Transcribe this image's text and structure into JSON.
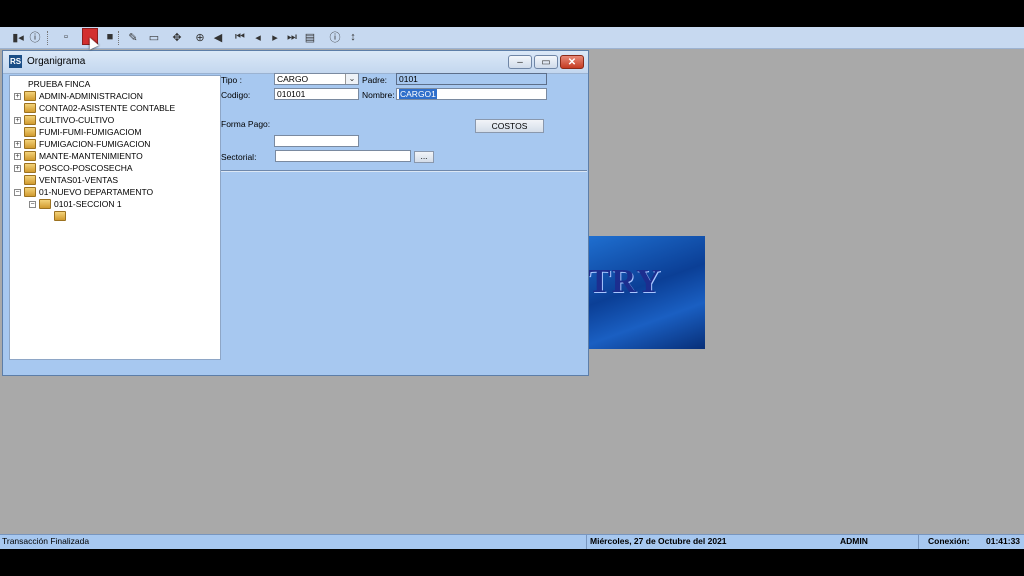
{
  "toolbar": {
    "icons": [
      "exit-icon",
      "help-icon",
      "new-icon",
      "save-icon",
      "stop-icon",
      "edit-icon",
      "open-icon",
      "refresh-icon",
      "search-icon",
      "back-icon",
      "first-icon",
      "prev-icon",
      "next-icon",
      "last-icon",
      "print-icon",
      "help2-icon",
      "sort-icon"
    ]
  },
  "window": {
    "title": "Organigrama",
    "min_glyph": "–",
    "max_glyph": "▭",
    "close_glyph": "✕"
  },
  "tree": {
    "root": "PRUEBA FINCA",
    "items": [
      "ADMIN-ADMINISTRACION",
      "CONTA02-ASISTENTE CONTABLE",
      "CULTIVO-CULTIVO",
      "FUMI-FUMI-FUMIGACIOM",
      "FUMIGACION-FUMIGACION",
      "MANTE-MANTENIMIENTO",
      "POSCO-POSCOSECHA",
      "VENTAS01-VENTAS",
      "01-NUEVO DEPARTAMENTO"
    ],
    "child": "0101-SECCION 1"
  },
  "form": {
    "tipo_label": "Tipo :",
    "tipo_value": "CARGO",
    "padre_label": "Padre:",
    "padre_value": "0101",
    "codigo_label": "Codigo:",
    "codigo_value": "010101",
    "nombre_label": "Nombre:",
    "nombre_value": "CARGO1",
    "forma_pago_label": "Forma  Pago:",
    "forma_pago_value": "",
    "sectorial_label": "Sectorial:",
    "sectorial_value": "",
    "costos_button": "COSTOS",
    "browse_button": "..."
  },
  "splash": {
    "text": "TRY"
  },
  "status": {
    "message": "Transacción Finalizada",
    "date": "Miércoles, 27 de Octubre del 2021",
    "user": "ADMIN",
    "connection_label": "Conexión:",
    "connection_time": "01:41:33"
  }
}
